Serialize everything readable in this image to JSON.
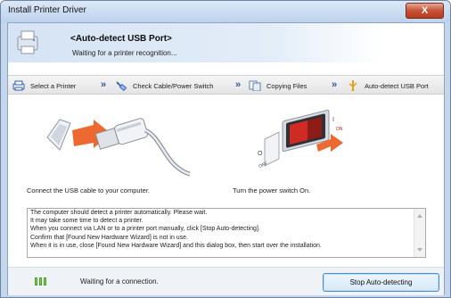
{
  "window": {
    "title": "Install Printer Driver",
    "close_label": "X"
  },
  "header": {
    "title": "<Auto-detect USB Port>",
    "subtitle": "Waiting for a printer recognition..."
  },
  "steps": [
    {
      "label": "Select a Printer",
      "icon": "printer-icon"
    },
    {
      "label": "Check Cable/Power Switch",
      "icon": "cable-icon"
    },
    {
      "label": "Copying Files",
      "icon": "copy-files-icon"
    },
    {
      "label": "Auto-detect USB Port",
      "icon": "usb-port-icon"
    }
  ],
  "illustrations": {
    "usb": {
      "caption": "Connect the USB cable to your computer."
    },
    "power": {
      "caption": "Turn the power switch On.",
      "switch_off_label": "O OFF",
      "switch_on_label": "I ON",
      "left_mark": "O",
      "right_mark": "I"
    }
  },
  "message": {
    "lines": [
      "The computer should detect a printer automatically. Please wait.",
      "It may take some time to detect a printer.",
      "When you connect via LAN or to a printer port manually, click [Stop Auto-detecting].",
      "Confirm that [Found New Hardware Wizard] is not in use.",
      "When it is in use, close [Found New Hardware Wizard] and this dialog box, then start over the installation."
    ]
  },
  "footer": {
    "progress_segments": 3,
    "status": "Waiting for a connection.",
    "stop_button": "Stop Auto-detecting"
  },
  "colors": {
    "accent": "#2b5aa8",
    "arrow_orange": "#e8612c",
    "progress_green": "#7cd44d",
    "close_red": "#c75237"
  }
}
